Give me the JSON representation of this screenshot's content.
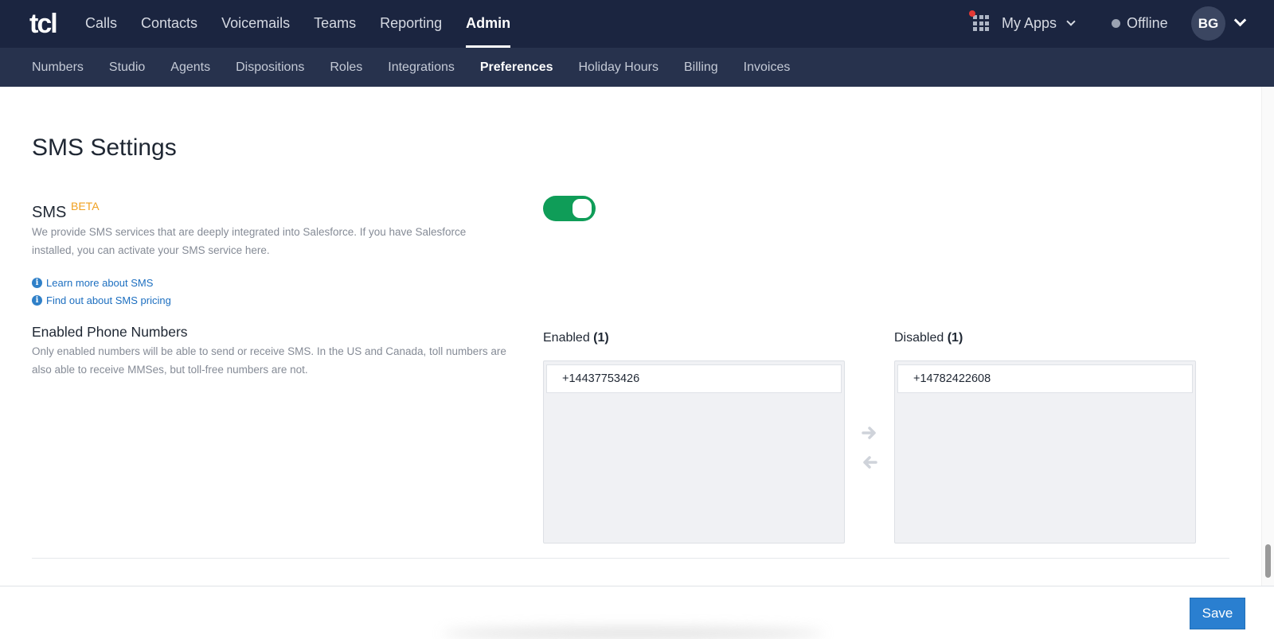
{
  "brand": {
    "logo_text": "tcl"
  },
  "top_nav": {
    "items": [
      {
        "label": "Calls"
      },
      {
        "label": "Contacts"
      },
      {
        "label": "Voicemails"
      },
      {
        "label": "Teams"
      },
      {
        "label": "Reporting"
      },
      {
        "label": "Admin"
      }
    ],
    "active": "Admin"
  },
  "header": {
    "apps_label": "My Apps",
    "status_label": "Offline",
    "avatar_initials": "BG"
  },
  "sub_nav": {
    "items": [
      {
        "label": "Numbers"
      },
      {
        "label": "Studio"
      },
      {
        "label": "Agents"
      },
      {
        "label": "Dispositions"
      },
      {
        "label": "Roles"
      },
      {
        "label": "Integrations"
      },
      {
        "label": "Preferences"
      },
      {
        "label": "Holiday Hours"
      },
      {
        "label": "Billing"
      },
      {
        "label": "Invoices"
      }
    ],
    "active": "Preferences"
  },
  "sms_settings": {
    "title": "SMS Settings",
    "sms_label": "SMS",
    "beta_badge": "BETA",
    "sms_description": "We provide SMS services that are deeply integrated into Salesforce. If you have Salesforce installed, you can activate your SMS service here.",
    "learn_more_link": "Learn more about SMS",
    "pricing_link": "Find out about SMS pricing",
    "sms_enabled": true,
    "enabled_numbers_label": "Enabled Phone Numbers",
    "enabled_numbers_description": "Only enabled numbers will be able to send or receive SMS. In the US and Canada, toll numbers are also able to receive MMSes, but toll-free numbers are not.",
    "enabled_list": {
      "title": "Enabled",
      "count": "(1)",
      "numbers": [
        "+14437753426"
      ]
    },
    "disabled_list": {
      "title": "Disabled",
      "count": "(1)",
      "numbers": [
        "+14782422608"
      ]
    }
  },
  "footer": {
    "save_label": "Save"
  },
  "colors": {
    "nav_bg": "#1b2540",
    "subnav_bg": "#27324d",
    "toggle_on": "#0f9d58",
    "beta": "#f0a020",
    "link": "#1d6fc0",
    "save_button": "#2a7fd0"
  }
}
